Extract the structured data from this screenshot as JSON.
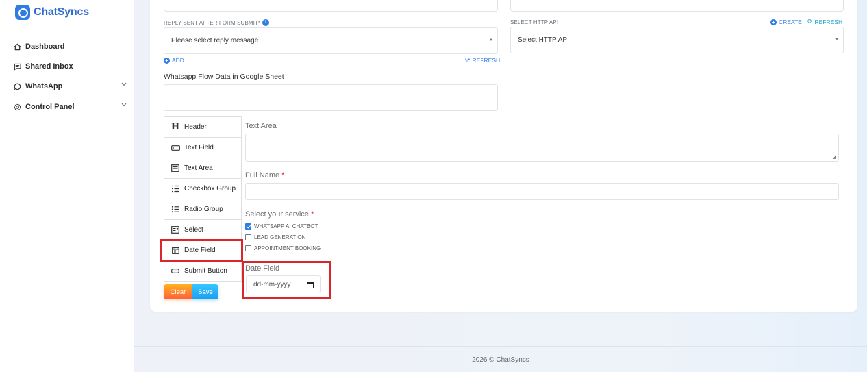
{
  "brand": {
    "name": "ChatSyncs"
  },
  "sidebar": {
    "items": [
      {
        "label": "Dashboard",
        "icon": "home-icon"
      },
      {
        "label": "Shared Inbox",
        "icon": "inbox-icon"
      },
      {
        "label": "WhatsApp",
        "icon": "whatsapp-icon",
        "has_submenu": true
      },
      {
        "label": "Control Panel",
        "icon": "gear-icon",
        "has_submenu": true
      }
    ]
  },
  "form": {
    "reply_label": "REPLY SENT AFTER FORM SUBMIT*",
    "reply_select": "Please select reply message",
    "add_link": "ADD",
    "refresh_link": "REFRESH",
    "http_api_label": "SELECT HTTP API",
    "http_api_select": "Select HTTP API",
    "create_link": "CREATE",
    "refresh_link_2": "REFRESH",
    "sheet_label": "Whatsapp Flow Data in Google Sheet"
  },
  "palette": {
    "items": [
      {
        "label": "Header",
        "icon": "heading-icon"
      },
      {
        "label": "Text Field",
        "icon": "text-field-icon"
      },
      {
        "label": "Text Area",
        "icon": "text-area-icon"
      },
      {
        "label": "Checkbox Group",
        "icon": "checkbox-group-icon"
      },
      {
        "label": "Radio Group",
        "icon": "radio-group-icon"
      },
      {
        "label": "Select",
        "icon": "select-icon"
      },
      {
        "label": "Date Field",
        "icon": "calendar-icon"
      },
      {
        "label": "Submit Button",
        "icon": "button-icon"
      }
    ],
    "clear_label": "Clear",
    "save_label": "Save"
  },
  "stage": {
    "text_area_label": "Text Area",
    "full_name_label": "Full Name",
    "required_mark": "*",
    "service_label": "Select your service",
    "services": [
      {
        "label": "WHATSAPP AI CHATBOT",
        "checked": true
      },
      {
        "label": "LEAD GENERATION",
        "checked": false
      },
      {
        "label": "APPOINTMENT BOOKING",
        "checked": false
      }
    ],
    "date_label": "Date Field",
    "date_placeholder": "dd-mm-yyyy"
  },
  "colors": {
    "primary": "#2f7de1",
    "highlight": "#d9262b",
    "clear_btn": "#ff7a2f",
    "save_btn": "#22aaf5"
  },
  "footer": {
    "text": "2026 © ChatSyncs"
  }
}
